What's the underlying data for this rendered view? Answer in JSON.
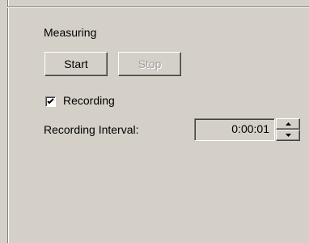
{
  "group": {
    "title": "Measuring"
  },
  "buttons": {
    "start_label": "Start",
    "stop_label": "Stop",
    "stop_enabled": false
  },
  "recording": {
    "checkbox_label": "Recording",
    "checked": true
  },
  "interval": {
    "label": "Recording Interval:",
    "value": "0:00:01"
  },
  "icons": {
    "checkmark": "checkmark-icon",
    "spin_up": "arrow-up-icon",
    "spin_down": "arrow-down-icon"
  }
}
